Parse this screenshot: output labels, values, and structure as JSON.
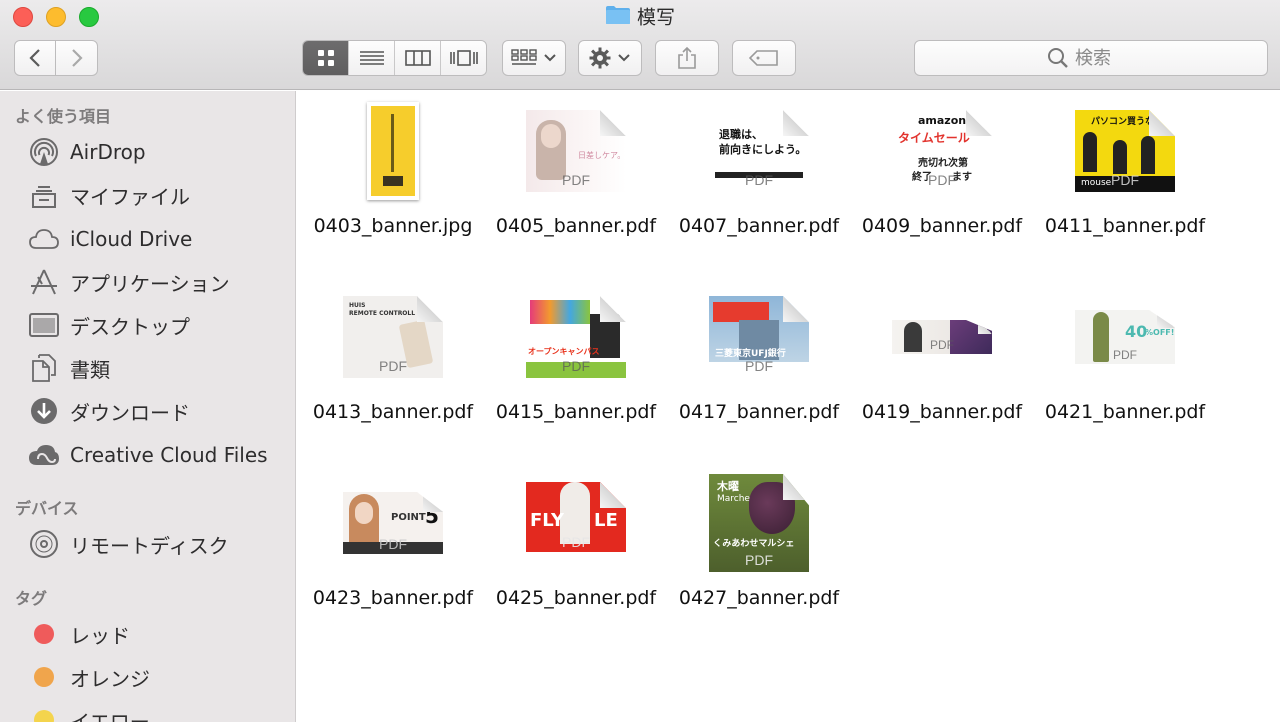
{
  "window": {
    "title": "模写"
  },
  "toolbar": {
    "back_icon": "chevron-left-icon",
    "forward_icon": "chevron-right-icon",
    "view_modes": [
      "icon-view",
      "list-view",
      "column-view",
      "cover-flow-view"
    ],
    "active_view": "icon-view",
    "search_placeholder": "検索"
  },
  "sidebar": {
    "favorites_heading": "よく使う項目",
    "favorites": [
      {
        "label": "AirDrop",
        "icon": "airdrop-icon"
      },
      {
        "label": "マイファイル",
        "icon": "all-my-files-icon"
      },
      {
        "label": "iCloud Drive",
        "icon": "cloud-icon"
      },
      {
        "label": "アプリケーション",
        "icon": "applications-icon"
      },
      {
        "label": "デスクトップ",
        "icon": "desktop-icon"
      },
      {
        "label": "書類",
        "icon": "documents-icon"
      },
      {
        "label": "ダウンロード",
        "icon": "download-icon"
      },
      {
        "label": "Creative Cloud Files",
        "icon": "creative-cloud-icon"
      }
    ],
    "devices_heading": "デバイス",
    "devices": [
      {
        "label": "リモートディスク",
        "icon": "remote-disc-icon"
      }
    ],
    "tags_heading": "タグ",
    "tags": [
      {
        "label": "レッド",
        "color": "#ef5b5b"
      },
      {
        "label": "オレンジ",
        "color": "#f0a54c"
      },
      {
        "label": "イエロー",
        "color": "#f4d44d"
      }
    ]
  },
  "files": [
    {
      "name": "0403_banner.jpg",
      "thumb_text": [
        "",
        "",
        "",
        ""
      ]
    },
    {
      "name": "0405_banner.pdf",
      "thumb_text": [
        "日差しケア。",
        "PDF"
      ]
    },
    {
      "name": "0407_banner.pdf",
      "thumb_text": [
        "退職は、",
        "前向きにしよう。",
        "PDF"
      ]
    },
    {
      "name": "0409_banner.pdf",
      "thumb_text": [
        "amazon",
        "タイムセール",
        "売切れ次第",
        "終了",
        "ます",
        "PDF"
      ]
    },
    {
      "name": "0411_banner.pdf",
      "thumb_text": [
        "パソコン買うな",
        "mouse",
        "PDF"
      ]
    },
    {
      "name": "0413_banner.pdf",
      "thumb_text": [
        "HUIS",
        "REMOTE CONTROLL",
        "PDF"
      ]
    },
    {
      "name": "0415_banner.pdf",
      "thumb_text": [
        "オープンキャンパス",
        "PDF"
      ]
    },
    {
      "name": "0417_banner.pdf",
      "thumb_text": [
        "三菱東京UFJ銀行",
        "PDF"
      ]
    },
    {
      "name": "0419_banner.pdf",
      "thumb_text": [
        "PDF"
      ]
    },
    {
      "name": "0421_banner.pdf",
      "thumb_text": [
        "40",
        "%OFF!",
        "PDF"
      ]
    },
    {
      "name": "0423_banner.pdf",
      "thumb_text": [
        "POINT",
        "5",
        "PDF"
      ]
    },
    {
      "name": "0425_banner.pdf",
      "thumb_text": [
        "FLY",
        "LE",
        "PDF"
      ]
    },
    {
      "name": "0427_banner.pdf",
      "thumb_text": [
        "木曜",
        "Marche",
        "くみあわせマルシェ",
        "PDF"
      ]
    }
  ]
}
